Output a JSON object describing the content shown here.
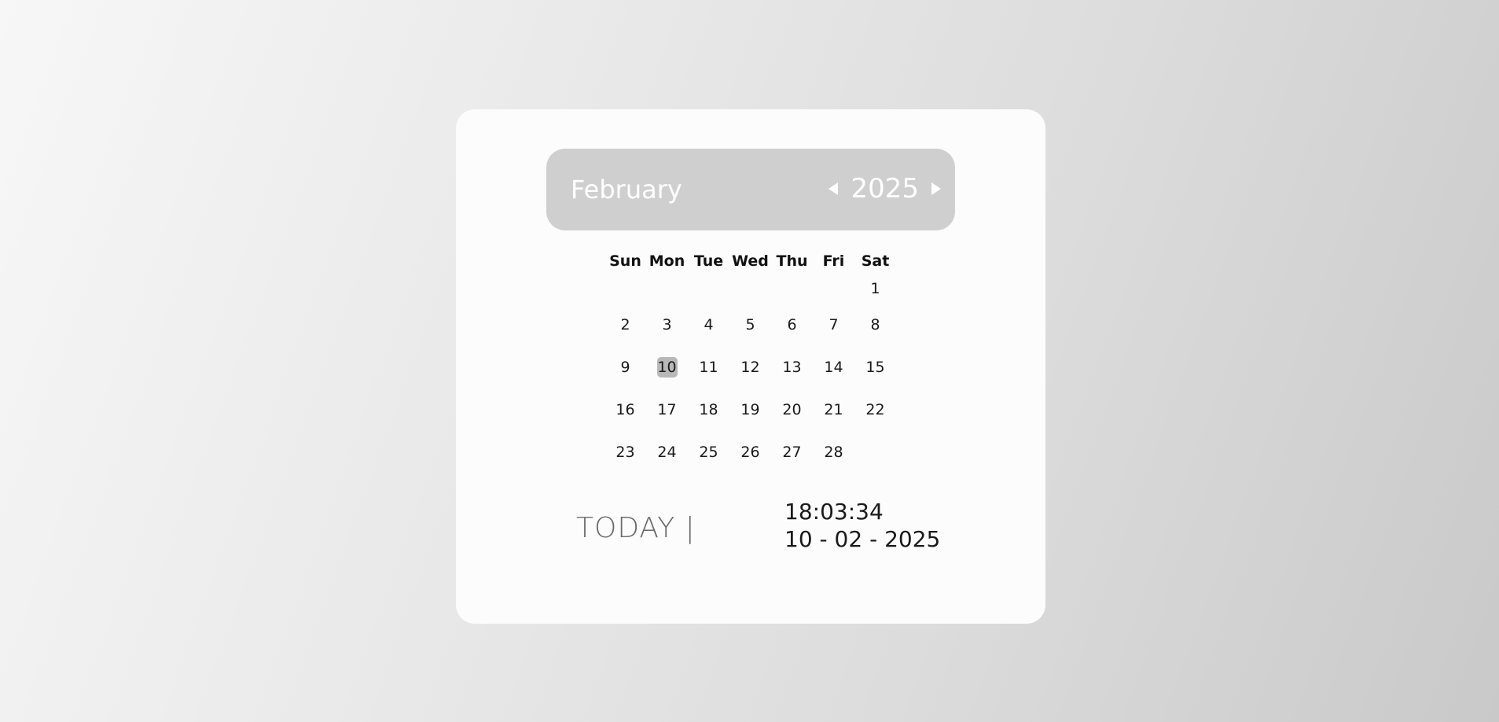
{
  "calendar": {
    "month": "February",
    "year": "2025",
    "weekdays": [
      "Sun",
      "Mon",
      "Tue",
      "Wed",
      "Thu",
      "Fri",
      "Sat"
    ],
    "weeks": [
      [
        "",
        "",
        "",
        "",
        "",
        "",
        "1"
      ],
      [
        "2",
        "3",
        "4",
        "5",
        "6",
        "7",
        "8"
      ],
      [
        "9",
        "10",
        "11",
        "12",
        "13",
        "14",
        "15"
      ],
      [
        "16",
        "17",
        "18",
        "19",
        "20",
        "21",
        "22"
      ],
      [
        "23",
        "24",
        "25",
        "26",
        "27",
        "28",
        ""
      ]
    ],
    "selected_day": "10"
  },
  "footer": {
    "today_label": "TODAY |",
    "time": "18:03:34",
    "date": "10 - 02 - 2025"
  },
  "colors": {
    "header_bg": "#cfcfcf",
    "selected_bg": "#b8b8b8",
    "card_bg": "#fcfcfc"
  }
}
